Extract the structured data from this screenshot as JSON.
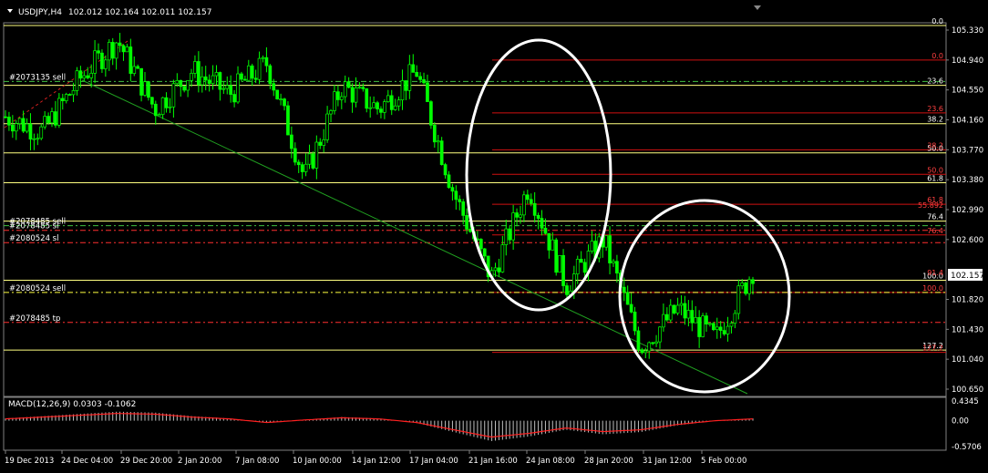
{
  "header": {
    "symbol": "USDJPY,H4",
    "ohlc": "102.012 102.164 102.011 102.157"
  },
  "colors": {
    "background": "#000000",
    "bull_candle": "#00ff00",
    "bear_candle": "#00ff00",
    "yellow_line": "#ffff80",
    "red_line": "#d01010",
    "trend_line": "#20a020",
    "ellipse": "#ffffff",
    "macd_hist": "#c0c0c0",
    "macd_signal": "#ff2020",
    "price_box": "#ffffff"
  },
  "price_axis": {
    "labels": [
      "105.330",
      "104.940",
      "104.550",
      "104.160",
      "103.770",
      "103.380",
      "102.990",
      "102.600",
      "101.820",
      "101.430",
      "101.040",
      "100.650"
    ],
    "current_price": "102.157",
    "min": 100.65,
    "max": 105.33
  },
  "time_axis": {
    "labels": [
      "19 Dec 2013",
      "24 Dec 04:00",
      "29 Dec 20:00",
      "2 Jan 20:00",
      "7 Jan 08:00",
      "10 Jan 00:00",
      "14 Jan 12:00",
      "17 Jan 04:00",
      "21 Jan 16:00",
      "24 Jan 08:00",
      "28 Jan 20:00",
      "31 Jan 12:00",
      "5 Feb 00:00"
    ]
  },
  "fibo_big": {
    "levels": [
      "0.0",
      "23.6",
      "38.2",
      "50.0",
      "61.8",
      "76.4",
      "100.0",
      "127.2"
    ],
    "prices": [
      105.39,
      104.61,
      104.11,
      103.73,
      103.34,
      102.84,
      102.07,
      101.16
    ]
  },
  "fibo_small": {
    "levels": [
      "0.0",
      "23.6",
      "38.2",
      "50.0",
      "61.8",
      "76.4",
      "100.0",
      "127.2"
    ],
    "overlap_labels": [
      "55.892",
      "91.4"
    ],
    "prices": [
      104.94,
      104.25,
      103.77,
      103.45,
      103.06,
      102.66,
      101.91,
      101.13
    ]
  },
  "orders": [
    {
      "label": "#2073135 sell",
      "price": 104.66,
      "style": "dash-green"
    },
    {
      "label": "#2078485 sell",
      "price": 102.78,
      "style": "dash-green"
    },
    {
      "label": "#2078485 sl",
      "price": 102.72,
      "style": "dash-red"
    },
    {
      "label": "#2080524 sl",
      "price": 102.56,
      "style": "dash-red"
    },
    {
      "label": "#2080524 sell",
      "price": 101.91,
      "style": "dash-yellow"
    },
    {
      "label": "#2078485 tp",
      "price": 101.52,
      "style": "dash-red"
    }
  ],
  "indicator": {
    "name": "MACD(12,26,9) 0.0303 -0.1062",
    "axis_labels": [
      "0.4345",
      "0.00",
      "-0.5706"
    ],
    "min": -0.5706,
    "max": 0.4345
  },
  "chart_data": {
    "type": "line",
    "xlabel": "",
    "ylabel": "",
    "ylim": [
      100.65,
      105.33
    ],
    "x": [
      "19 Dec 2013",
      "24 Dec 04:00",
      "29 Dec 20:00",
      "2 Jan 20:00",
      "7 Jan 08:00",
      "10 Jan 00:00",
      "14 Jan 12:00",
      "17 Jan 04:00",
      "21 Jan 16:00",
      "24 Jan 08:00",
      "28 Jan 20:00",
      "31 Jan 12:00",
      "5 Feb 00:00"
    ],
    "price_path": [
      104.2,
      104.0,
      104.7,
      105.2,
      104.3,
      104.8,
      104.5,
      104.9,
      103.4,
      104.6,
      104.3,
      104.8,
      103.2,
      102.1,
      103.3,
      102.0,
      102.6,
      101.2,
      101.7,
      101.3,
      102.2
    ],
    "macd": [
      0.05,
      0.1,
      0.15,
      0.2,
      0.18,
      0.1,
      0.05,
      -0.05,
      0.02,
      0.08,
      0.05,
      -0.05,
      -0.25,
      -0.45,
      -0.35,
      -0.2,
      -0.3,
      -0.25,
      -0.1,
      0.0,
      0.05
    ]
  }
}
